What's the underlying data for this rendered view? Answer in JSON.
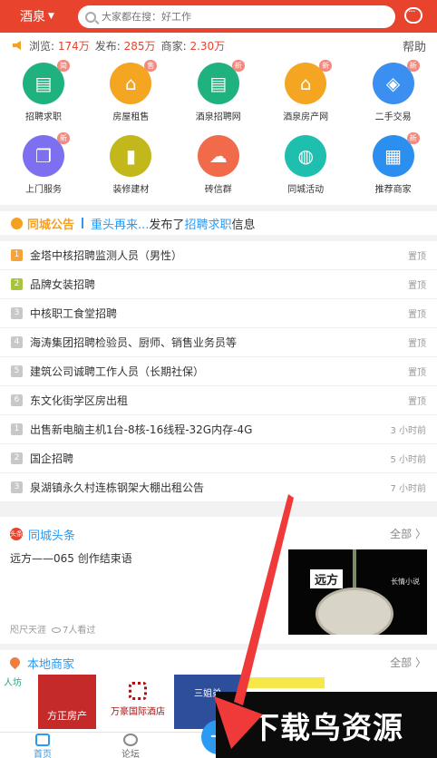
{
  "header": {
    "city": "酒泉",
    "search_placeholder": "大家都在搜：好工作",
    "color": "#e8432c"
  },
  "stats": {
    "views_label": "浏览:",
    "views": "174万",
    "posts_label": "发布:",
    "posts": "285万",
    "merchants_label": "商家:",
    "merchants": "2.30万",
    "help": "帮助"
  },
  "grid": [
    {
      "label": "招聘求职",
      "badge": "简",
      "color": "#1fb27f",
      "icon": "id-card-icon"
    },
    {
      "label": "房屋租售",
      "badge": "售",
      "color": "#f4a623",
      "icon": "house-icon"
    },
    {
      "label": "酒泉招聘网",
      "badge": "新",
      "color": "#1fb27f",
      "icon": "id-card-icon"
    },
    {
      "label": "酒泉房产网",
      "badge": "新",
      "color": "#f4a623",
      "icon": "house-icon"
    },
    {
      "label": "二手交易",
      "badge": "新",
      "color": "#3b8ff0",
      "icon": "tag-icon"
    },
    {
      "label": "上门服务",
      "badge": "新",
      "color": "#7c6ff0",
      "icon": "copy-icon"
    },
    {
      "label": "装修建材",
      "badge": "",
      "color": "#c2b81b",
      "icon": "paint-roller-icon"
    },
    {
      "label": "砖信群",
      "badge": "",
      "color": "#f16a4a",
      "icon": "chat-icon"
    },
    {
      "label": "同城活动",
      "badge": "",
      "color": "#1fbfb0",
      "icon": "balloon-icon"
    },
    {
      "label": "推荐商家",
      "badge": "新",
      "color": "#2b8ff0",
      "icon": "shop-icon"
    }
  ],
  "notice": {
    "title": "同城公告",
    "user": "重头再来...",
    "text": "发布了",
    "category": "招聘求职",
    "suffix": "信息"
  },
  "list": [
    {
      "num": "1",
      "title": "金塔中核招聘监测人员（男性）",
      "meta": "置顶",
      "numColor": "#f6a43a"
    },
    {
      "num": "2",
      "title": "品牌女装招聘",
      "meta": "置顶",
      "numColor": "#a6c53a"
    },
    {
      "num": "3",
      "title": "中核职工食堂招聘",
      "meta": "置顶",
      "numColor": "#c8c8c8"
    },
    {
      "num": "4",
      "title": "海涛集团招聘检验员、厨师、销售业务员等",
      "meta": "置顶",
      "numColor": "#c8c8c8"
    },
    {
      "num": "5",
      "title": "建筑公司诚聘工作人员（长期社保）",
      "meta": "置顶",
      "numColor": "#c8c8c8"
    },
    {
      "num": "6",
      "title": "东文化街学区房出租",
      "meta": "置顶",
      "numColor": "#c8c8c8"
    },
    {
      "num": "1",
      "title": "出售新电脑主机1台-8核-16线程-32G内存-4G",
      "meta": "3 小时前",
      "numColor": "#c8c8c8"
    },
    {
      "num": "2",
      "title": "国企招聘",
      "meta": "5 小时前",
      "numColor": "#c8c8c8"
    },
    {
      "num": "3",
      "title": "泉湖镇永久村连栋钢架大棚出租公告",
      "meta": "7 小时前",
      "numColor": "#c8c8c8"
    }
  ],
  "headline": {
    "icon_text": "头条",
    "title": "同城头条",
    "all": "全部 〉",
    "article": "远方——065 创作结束语",
    "author": "咫尺天涯",
    "views": "7人看过",
    "thumb_label": "远方",
    "thumb_small": "长情小说"
  },
  "merchants": {
    "title": "本地商家",
    "all": "全部 〉",
    "logo1": "方正房产",
    "logo2": "万豪国际酒店",
    "logo3": "三姐弟",
    "logo_left": "人坊"
  },
  "tabbar": {
    "home": "首页",
    "forum": "论坛",
    "publish": "发",
    "publish_plus": "+"
  },
  "watermark": "下载鸟资源"
}
